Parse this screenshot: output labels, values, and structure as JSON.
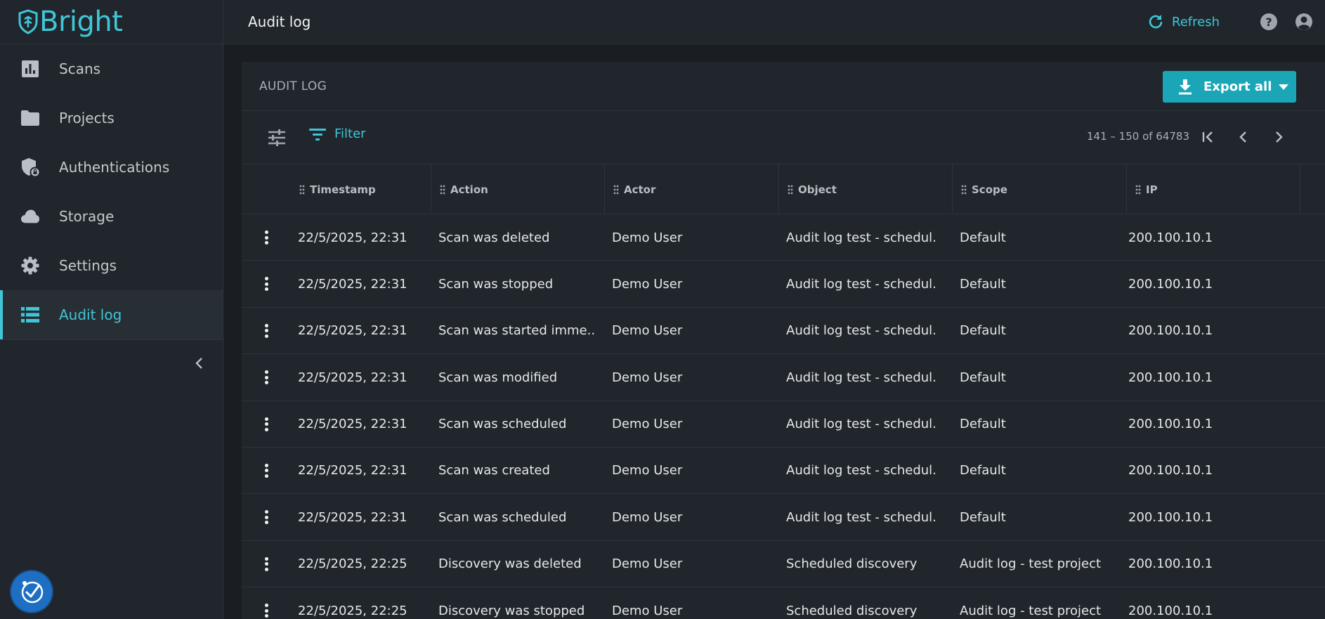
{
  "brand": {
    "name": "Bright"
  },
  "colors": {
    "accent": "#3fc6d8",
    "export_button": "#1aa6b7",
    "sidebar_bg": "#20262b"
  },
  "sidebar": {
    "items": [
      {
        "label": "Scans",
        "icon": "bar-chart-icon"
      },
      {
        "label": "Projects",
        "icon": "folder-icon"
      },
      {
        "label": "Authentications",
        "icon": "shield-lock-icon"
      },
      {
        "label": "Storage",
        "icon": "cloud-icon"
      },
      {
        "label": "Settings",
        "icon": "gear-icon"
      },
      {
        "label": "Audit log",
        "icon": "list-icon",
        "active": true
      }
    ]
  },
  "header": {
    "title": "Audit log",
    "refresh_label": "Refresh"
  },
  "card": {
    "title": "AUDIT LOG",
    "export_label": "Export all",
    "filter_label": "Filter",
    "page_range": "141 – 150 of 64783"
  },
  "table": {
    "columns": [
      "Timestamp",
      "Action",
      "Actor",
      "Object",
      "Scope",
      "IP"
    ],
    "rows": [
      [
        "22/5/2025, 22:31",
        "Scan was deleted",
        "Demo User",
        "Audit log test - schedul...",
        "Default",
        "200.100.10.1"
      ],
      [
        "22/5/2025, 22:31",
        "Scan was stopped",
        "Demo User",
        "Audit log test - schedul...",
        "Default",
        "200.100.10.1"
      ],
      [
        "22/5/2025, 22:31",
        "Scan was started imme...",
        "Demo User",
        "Audit log test - schedul...",
        "Default",
        "200.100.10.1"
      ],
      [
        "22/5/2025, 22:31",
        "Scan was modified",
        "Demo User",
        "Audit log test - schedul...",
        "Default",
        "200.100.10.1"
      ],
      [
        "22/5/2025, 22:31",
        "Scan was scheduled",
        "Demo User",
        "Audit log test - schedul...",
        "Default",
        "200.100.10.1"
      ],
      [
        "22/5/2025, 22:31",
        "Scan was created",
        "Demo User",
        "Audit log test - schedul...",
        "Default",
        "200.100.10.1"
      ],
      [
        "22/5/2025, 22:31",
        "Scan was scheduled",
        "Demo User",
        "Audit log test - schedul...",
        "Default",
        "200.100.10.1"
      ],
      [
        "22/5/2025, 22:25",
        "Discovery was deleted",
        "Demo User",
        "Scheduled discovery",
        "Audit log - test project",
        "200.100.10.1"
      ],
      [
        "22/5/2025, 22:25",
        "Discovery was stopped",
        "Demo User",
        "Scheduled discovery",
        "Audit log - test project",
        "200.100.10.1"
      ]
    ]
  }
}
